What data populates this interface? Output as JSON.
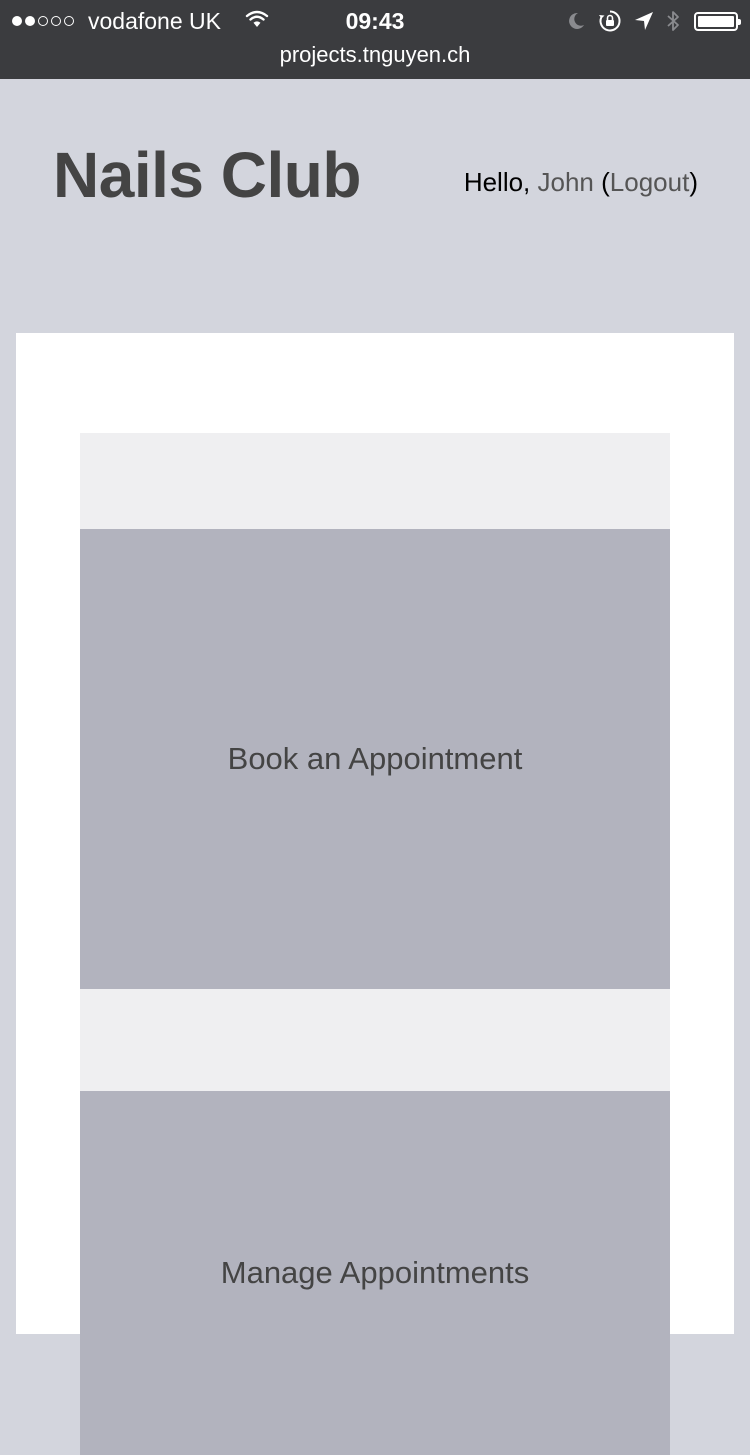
{
  "status_bar": {
    "signal_dots_filled": 2,
    "signal_dots_total": 5,
    "carrier": "vodafone UK",
    "time": "09:43",
    "icons": [
      "wifi-icon",
      "moon-icon",
      "rotation-lock-icon",
      "location-arrow-icon",
      "bluetooth-icon",
      "battery-icon"
    ],
    "battery_level": 1.0
  },
  "browser": {
    "url": "projects.tnguyen.ch"
  },
  "header": {
    "title": "Nails Club",
    "greeting_prefix": "Hello, ",
    "user_name": "John",
    "paren_open": " (",
    "logout_label": "Logout",
    "paren_close": ")"
  },
  "main": {
    "tiles": [
      {
        "label": "Book an Appointment"
      },
      {
        "label": "Manage Appointments"
      }
    ]
  },
  "colors": {
    "status_bar_bg": "#3b3c3f",
    "page_bg": "#d3d5dd",
    "card_bg": "#ffffff",
    "band_bg": "#efeff1",
    "tile_bg": "#b2b3be",
    "title_text": "#444444"
  }
}
